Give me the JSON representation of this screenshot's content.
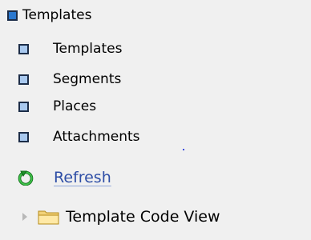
{
  "tree": {
    "root": {
      "label": "Templates",
      "icon": "blue-square-icon"
    },
    "children": [
      {
        "label": "Templates",
        "icon": "light-blue-square-icon"
      },
      {
        "label": "Segments",
        "icon": "light-blue-square-icon"
      },
      {
        "label": "Places",
        "icon": "light-blue-square-icon"
      },
      {
        "label": "Attachments",
        "icon": "light-blue-square-icon"
      }
    ]
  },
  "refresh": {
    "label": "Refresh",
    "icon": "refresh-icon",
    "color": "#2e4ea6"
  },
  "code_view": {
    "label": "Template Code View",
    "icon": "folder-icon",
    "expander_icon": "collapsed-triangle-icon"
  },
  "colors": {
    "background": "#f0f0f0",
    "square_fill": "#a9c9ef",
    "root_square_fill": "#2a78d0",
    "refresh_green": "#1f8f2a"
  }
}
